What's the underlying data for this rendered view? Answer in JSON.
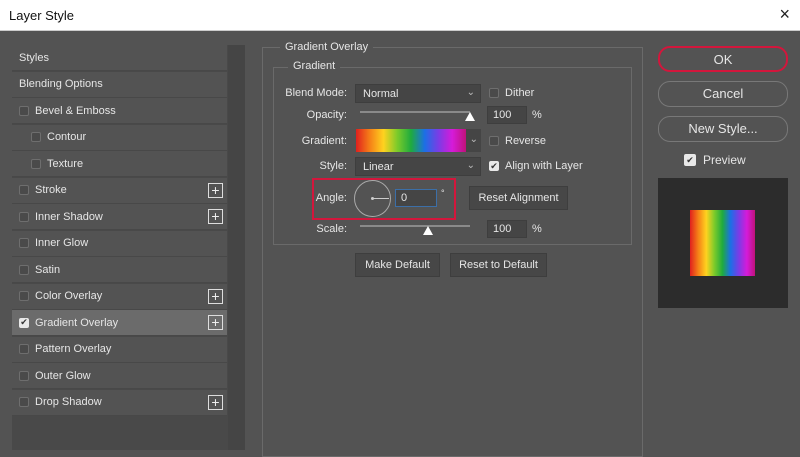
{
  "window": {
    "title": "Layer Style",
    "close_icon": "×"
  },
  "sidebar": {
    "items": [
      {
        "label": "Styles",
        "checkbox": false
      },
      {
        "label": "Blending Options",
        "checkbox": false
      },
      {
        "label": "Bevel & Emboss",
        "checkbox": true,
        "checked": false
      },
      {
        "label": "Contour",
        "checkbox": true,
        "checked": false,
        "indent": true
      },
      {
        "label": "Texture",
        "checkbox": true,
        "checked": false,
        "indent": true
      },
      {
        "label": "Stroke",
        "checkbox": true,
        "checked": false,
        "plus": true
      },
      {
        "label": "Inner Shadow",
        "checkbox": true,
        "checked": false,
        "plus": true
      },
      {
        "label": "Inner Glow",
        "checkbox": true,
        "checked": false
      },
      {
        "label": "Satin",
        "checkbox": true,
        "checked": false
      },
      {
        "label": "Color Overlay",
        "checkbox": true,
        "checked": false,
        "plus": true
      },
      {
        "label": "Gradient Overlay",
        "checkbox": true,
        "checked": true,
        "plus": true,
        "selected": true
      },
      {
        "label": "Pattern Overlay",
        "checkbox": true,
        "checked": false
      },
      {
        "label": "Outer Glow",
        "checkbox": true,
        "checked": false
      },
      {
        "label": "Drop Shadow",
        "checkbox": true,
        "checked": false,
        "plus": true
      }
    ]
  },
  "panel": {
    "group_title": "Gradient Overlay",
    "sub_title": "Gradient",
    "blend_mode_label": "Blend Mode:",
    "blend_mode": "Normal",
    "dither_label": "Dither",
    "dither": false,
    "opacity_label": "Opacity:",
    "opacity": "100",
    "opacity_unit": "%",
    "gradient_label": "Gradient:",
    "reverse_label": "Reverse",
    "reverse": false,
    "style_label": "Style:",
    "style": "Linear",
    "align_label": "Align with Layer",
    "align": true,
    "angle_label": "Angle:",
    "angle": "0",
    "angle_unit": "°",
    "reset_alignment": "Reset Alignment",
    "scale_label": "Scale:",
    "scale": "100",
    "scale_unit": "%",
    "make_default": "Make Default",
    "reset_default": "Reset to Default"
  },
  "actions": {
    "ok": "OK",
    "cancel": "Cancel",
    "new_style": "New Style...",
    "preview_label": "Preview",
    "preview": true
  },
  "colors": {
    "highlight": "#d3163c"
  }
}
